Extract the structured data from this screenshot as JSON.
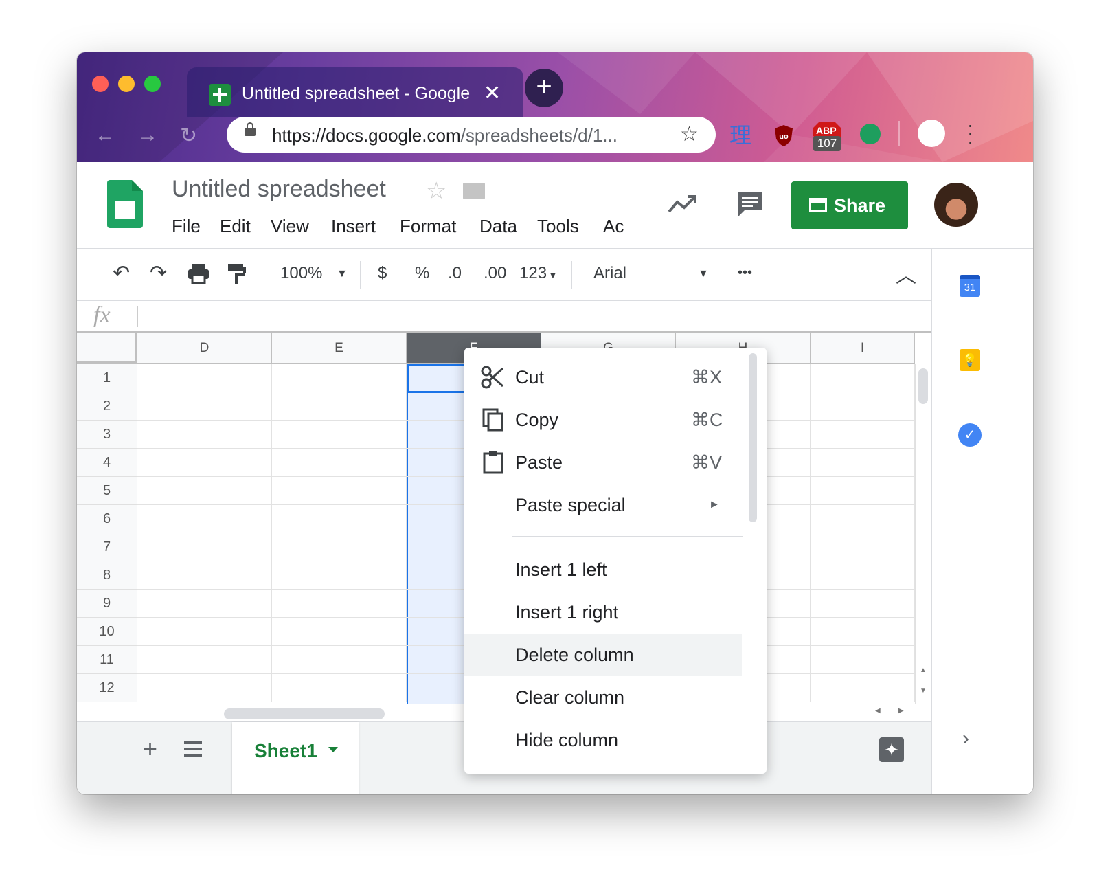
{
  "browser": {
    "tab_title": "Untitled spreadsheet - Google Sheets",
    "tab_close": "✕",
    "new_tab": "+",
    "url_host": "https://docs.google.com",
    "url_path": "/spreadsheets/d/1...",
    "extensions": {
      "kanji": "理",
      "abp_label": "ABP",
      "abp_count": "107"
    }
  },
  "doc": {
    "title": "Untitled spreadsheet",
    "menus": [
      "File",
      "Edit",
      "View",
      "Insert",
      "Format",
      "Data",
      "Tools",
      "Ac"
    ],
    "share_label": "Share"
  },
  "toolbar": {
    "zoom": "100%",
    "currency": "$",
    "percent": "%",
    "dec_less": ".0",
    "dec_more": ".00",
    "number_format": "123",
    "font": "Arial",
    "more": "•••"
  },
  "formula_bar": {
    "fx_label": "fx",
    "value": ""
  },
  "grid": {
    "columns": [
      "D",
      "E",
      "F",
      "G",
      "H",
      "I"
    ],
    "rows": [
      "1",
      "2",
      "3",
      "4",
      "5",
      "6",
      "7",
      "8",
      "9",
      "10",
      "11",
      "12"
    ],
    "selected_column": "F"
  },
  "sheets": {
    "add": "+",
    "tabs": [
      "Sheet1"
    ]
  },
  "side_panel": {
    "calendar_day": "31"
  },
  "context_menu": {
    "items": [
      {
        "label": "Cut",
        "shortcut": "⌘X",
        "icon": "scissors-icon"
      },
      {
        "label": "Copy",
        "shortcut": "⌘C",
        "icon": "copy-icon"
      },
      {
        "label": "Paste",
        "shortcut": "⌘V",
        "icon": "clipboard-icon"
      },
      {
        "label": "Paste special",
        "shortcut": "►",
        "icon": ""
      },
      {
        "label": "Insert 1 left",
        "shortcut": ""
      },
      {
        "label": "Insert 1 right",
        "shortcut": ""
      },
      {
        "label": "Delete column",
        "shortcut": "",
        "highlighted": true
      },
      {
        "label": "Clear column",
        "shortcut": ""
      },
      {
        "label": "Hide column",
        "shortcut": ""
      }
    ]
  },
  "colors": {
    "accent": "#1a73e8",
    "share_green": "#1e8e3e",
    "selection": "#e8f0fe"
  }
}
